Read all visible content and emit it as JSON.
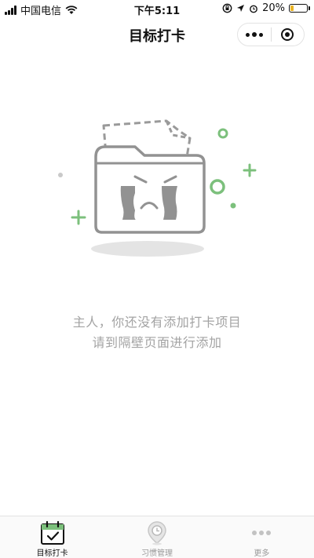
{
  "status_bar": {
    "carrier": "中国电信",
    "time": "下午5:11",
    "battery_percent": "20%",
    "battery_level": 0.2,
    "battery_color": "#e9b324"
  },
  "nav": {
    "title": "目标打卡",
    "more_icon": "more-dots-icon",
    "close_icon": "circle-close-icon"
  },
  "illustration": {
    "icon": "crying-folder-icon",
    "accent_color": "#7cc07c"
  },
  "empty_state": {
    "line1": "主人，你还没有添加打卡项目",
    "line2": "请到隔壁页面进行添加"
  },
  "tab_bar": {
    "active_color": "#111111",
    "inactive_color": "#9a9a9a",
    "items": [
      {
        "label": "目标打卡",
        "icon": "calendar-check-icon",
        "active": true
      },
      {
        "label": "习惯管理",
        "icon": "location-clock-icon",
        "active": false
      },
      {
        "label": "更多",
        "icon": "more-dots-icon",
        "active": false
      }
    ]
  }
}
